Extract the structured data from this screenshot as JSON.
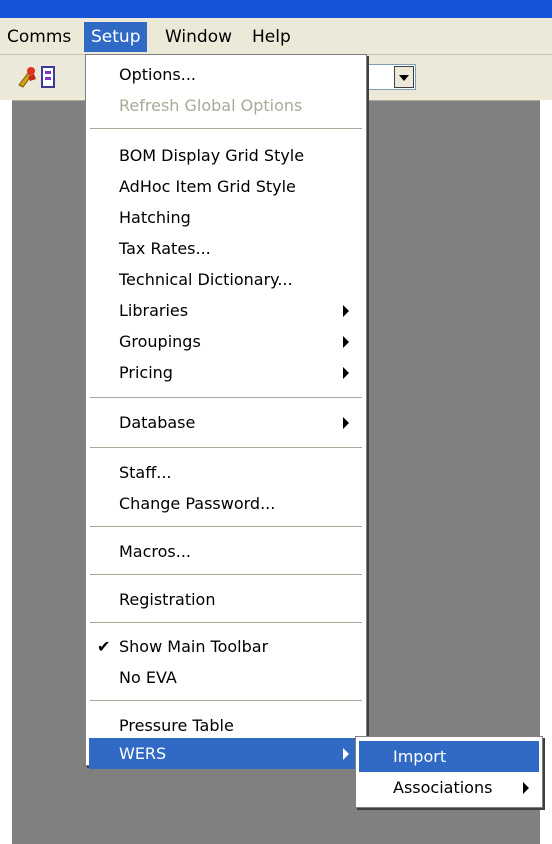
{
  "menubar": {
    "items": [
      {
        "label": "Comms"
      },
      {
        "label": "Setup"
      },
      {
        "label": "Window"
      },
      {
        "label": "Help"
      }
    ]
  },
  "toolbar": {
    "icons": [
      "person-wrench-icon",
      "document-icon"
    ],
    "combo_value": ""
  },
  "setup_menu": {
    "options": "Options...",
    "refresh_global_options": "Refresh Global Options",
    "bom_display_grid_style": "BOM Display Grid Style",
    "adhoc_item_grid_style": "AdHoc Item Grid Style",
    "hatching": "Hatching",
    "tax_rates": "Tax Rates...",
    "technical_dictionary": "Technical Dictionary...",
    "libraries": "Libraries",
    "groupings": "Groupings",
    "pricing": "Pricing",
    "database": "Database",
    "staff": "Staff...",
    "change_password": "Change Password...",
    "macros": "Macros...",
    "registration": "Registration",
    "show_main_toolbar": "Show Main Toolbar",
    "show_main_toolbar_checked": "✔",
    "no_eva": "No EVA",
    "pressure_table": "Pressure Table",
    "wers": "WERS"
  },
  "wers_submenu": {
    "import": "Import",
    "associations": "Associations"
  },
  "colors": {
    "highlight": "#316ac5",
    "menu_bg": "#ffffff",
    "menubar_bg": "#ece9d8",
    "workspace": "#808080",
    "disabled_text": "#aca899"
  }
}
